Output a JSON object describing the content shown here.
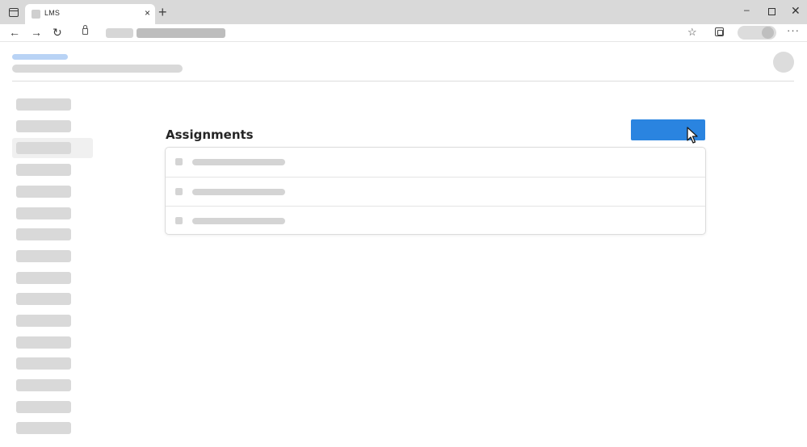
{
  "browser": {
    "tab_title": "LMS",
    "new_tab_glyph": "+",
    "tab_close_glyph": "×",
    "win_minimize_glyph": "–",
    "win_close_glyph": "✕",
    "nav_back_glyph": "←",
    "nav_forward_glyph": "→",
    "reload_glyph": "↻",
    "favorites_glyph": "☆",
    "more_glyph": "···",
    "icons": [
      "tab-manager-icon",
      "lock-icon",
      "favorites-icon",
      "collections-icon",
      "profile-icon",
      "more-icon"
    ]
  },
  "main": {
    "section_title": "Assignments",
    "primary_button_color": "#2a84e0",
    "assignment_rows": 3
  },
  "sidebar": {
    "item_count": 16,
    "active_index": 2
  },
  "colors": {
    "accent": "#2a84e0",
    "breadcrumb_placeholder": "#b9d3f5",
    "placeholder": "#d9d9d9"
  }
}
